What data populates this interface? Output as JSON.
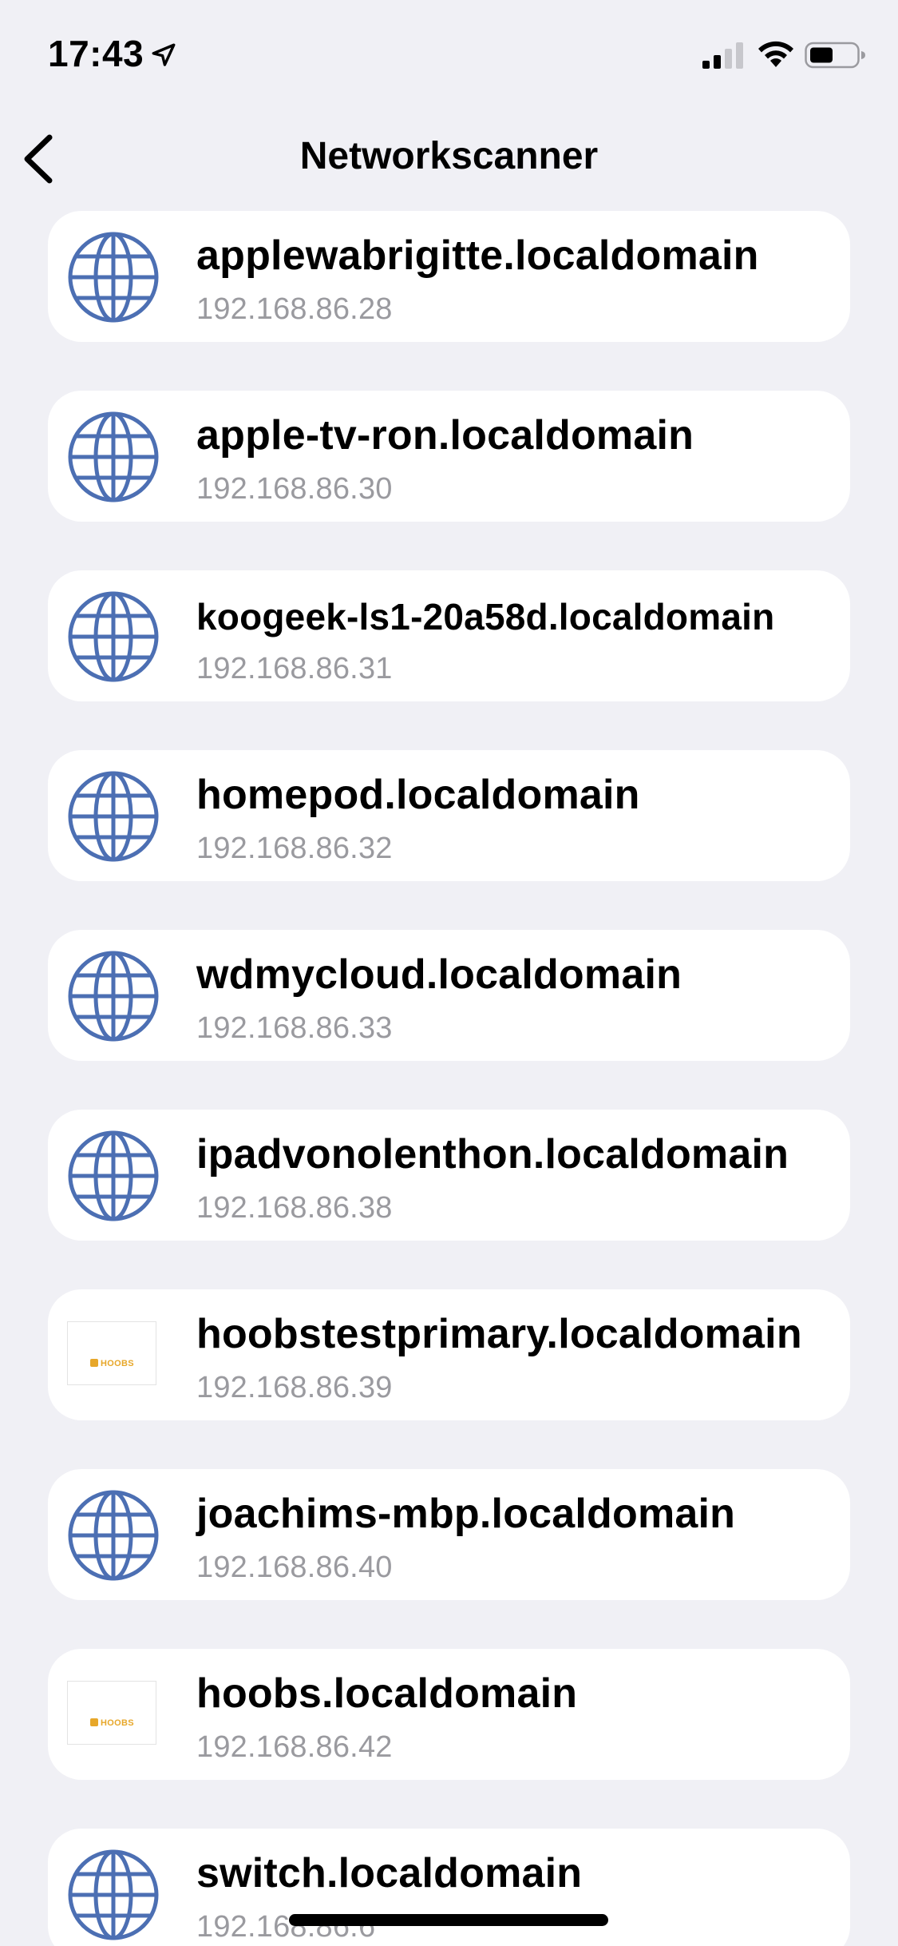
{
  "status_bar": {
    "time": "17:43",
    "icons": [
      "location-arrow-icon",
      "cellular-signal-icon",
      "wifi-icon",
      "battery-icon"
    ]
  },
  "nav": {
    "title": "Networkscanner",
    "back_icon": "chevron-left-icon"
  },
  "colors": {
    "background": "#f0f0f5",
    "card": "#ffffff",
    "globe": "#4c6fb3",
    "subtitle": "#9a9a9f",
    "hoobs": "#e7a72a"
  },
  "devices": [
    {
      "hostname": "applewabrigitte.localdomain",
      "ip": "192.168.86.28",
      "icon": "globe-icon"
    },
    {
      "hostname": "apple-tv-ron.localdomain",
      "ip": "192.168.86.30",
      "icon": "globe-icon"
    },
    {
      "hostname": "koogeek-ls1-20a58d.localdomain",
      "ip": "192.168.86.31",
      "icon": "globe-icon"
    },
    {
      "hostname": "homepod.localdomain",
      "ip": "192.168.86.32",
      "icon": "globe-icon"
    },
    {
      "hostname": "wdmycloud.localdomain",
      "ip": "192.168.86.33",
      "icon": "globe-icon"
    },
    {
      "hostname": "ipadvonolenthon.localdomain",
      "ip": "192.168.86.38",
      "icon": "globe-icon"
    },
    {
      "hostname": "hoobstestprimary.localdomain",
      "ip": "192.168.86.39",
      "icon": "hoobs-logo",
      "logo_text": "HOOBS"
    },
    {
      "hostname": "joachims-mbp.localdomain",
      "ip": "192.168.86.40",
      "icon": "globe-icon"
    },
    {
      "hostname": "hoobs.localdomain",
      "ip": "192.168.86.42",
      "icon": "hoobs-logo",
      "logo_text": "HOOBS"
    },
    {
      "hostname": "switch.localdomain",
      "ip": "192.168.86.6",
      "icon": "globe-icon"
    }
  ]
}
